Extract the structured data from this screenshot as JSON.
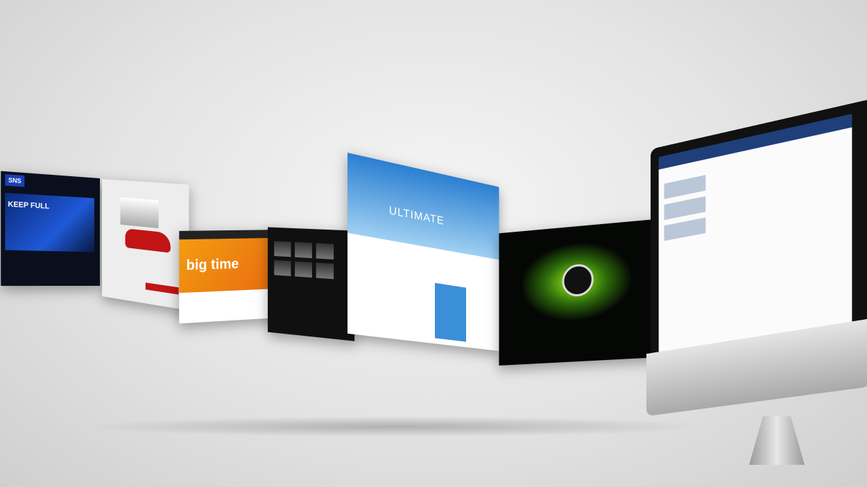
{
  "scene": {
    "description_free": true
  },
  "panels": [
    {
      "id": "p1",
      "headline": "KEEP FULL"
    },
    {
      "id": "p2",
      "headline": ""
    },
    {
      "id": "p3",
      "headline": "big time"
    },
    {
      "id": "p4",
      "headline": ""
    },
    {
      "id": "p5",
      "headline": "ULTIMATE"
    },
    {
      "id": "p6",
      "headline": ""
    }
  ],
  "colors": {
    "background": "#e3e3e3",
    "accent_green": "#9ef01a",
    "accent_orange": "#f39c12",
    "accent_blue": "#1e59d8"
  }
}
